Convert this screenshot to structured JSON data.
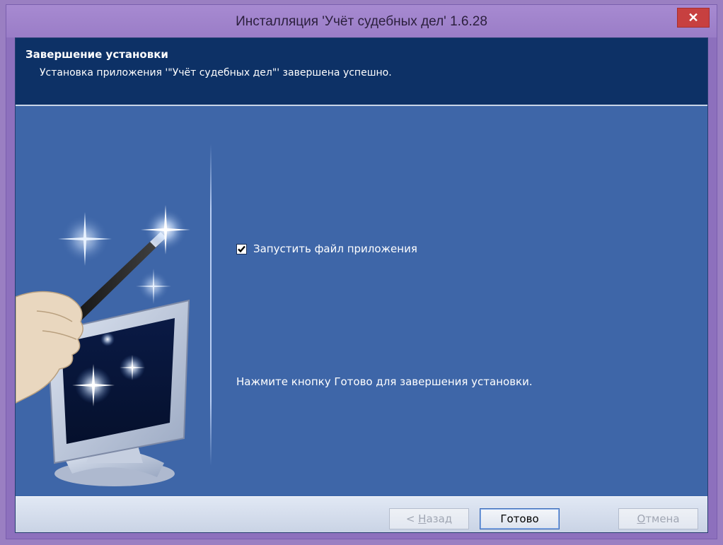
{
  "window": {
    "title": "Инсталляция 'Учёт судебных дел' 1.6.28",
    "close_label": "✕"
  },
  "header": {
    "title": "Завершение установки",
    "subtitle": "Установка приложения '\"Учёт судебных дел\"' завершена успешно."
  },
  "main": {
    "run_checkbox": {
      "label": "Запустить файл приложения",
      "checked": true
    },
    "hint": "Нажмите кнопку Готово для завершения установки."
  },
  "footer": {
    "back_prefix": "< ",
    "back_accel": "Н",
    "back_rest": "азад",
    "finish_label": "Готово",
    "cancel_accel": "О",
    "cancel_rest": "тмена"
  },
  "colors": {
    "window_frame": "#9a7dc7",
    "header_bg": "#0d3166",
    "body_bg": "#3e66a8",
    "close_button": "#c74040"
  },
  "icons": [
    "close-icon",
    "checkbox-check-icon",
    "wizard-wand-icon"
  ]
}
